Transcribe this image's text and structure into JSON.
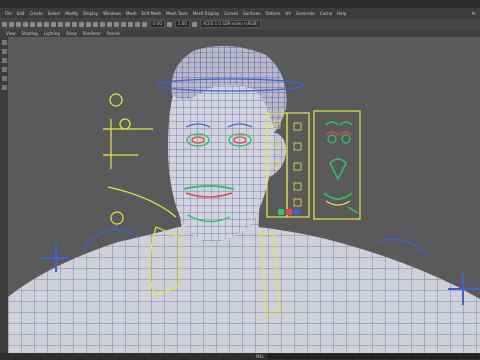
{
  "menu": [
    "File",
    "Edit",
    "Create",
    "Select",
    "Modify",
    "Display",
    "Windows",
    "Mesh",
    "Edit Mesh",
    "Mesh Tools",
    "Mesh Display",
    "Curves",
    "Surfaces",
    "Deform",
    "UV",
    "Generate",
    "Cache",
    "Help"
  ],
  "menu_right": "Ar",
  "toolbar": {
    "field_a": "0.00",
    "field_b": "1.00",
    "camera_field": "ACES 1.0 SDR-video (sRGB)"
  },
  "panel_menu": [
    "View",
    "Shading",
    "Lighting",
    "Show",
    "Renderer",
    "Panels"
  ],
  "status": {
    "label": "MEL"
  },
  "colors": {
    "viewport_bg": "#5a5a5a",
    "wire": "#1e2aa0",
    "rig_yellow": "#e6e640",
    "ctrl_blue": "#3b63d6",
    "lip_green": "#2fc46a",
    "eye_red": "#e24a4a"
  }
}
